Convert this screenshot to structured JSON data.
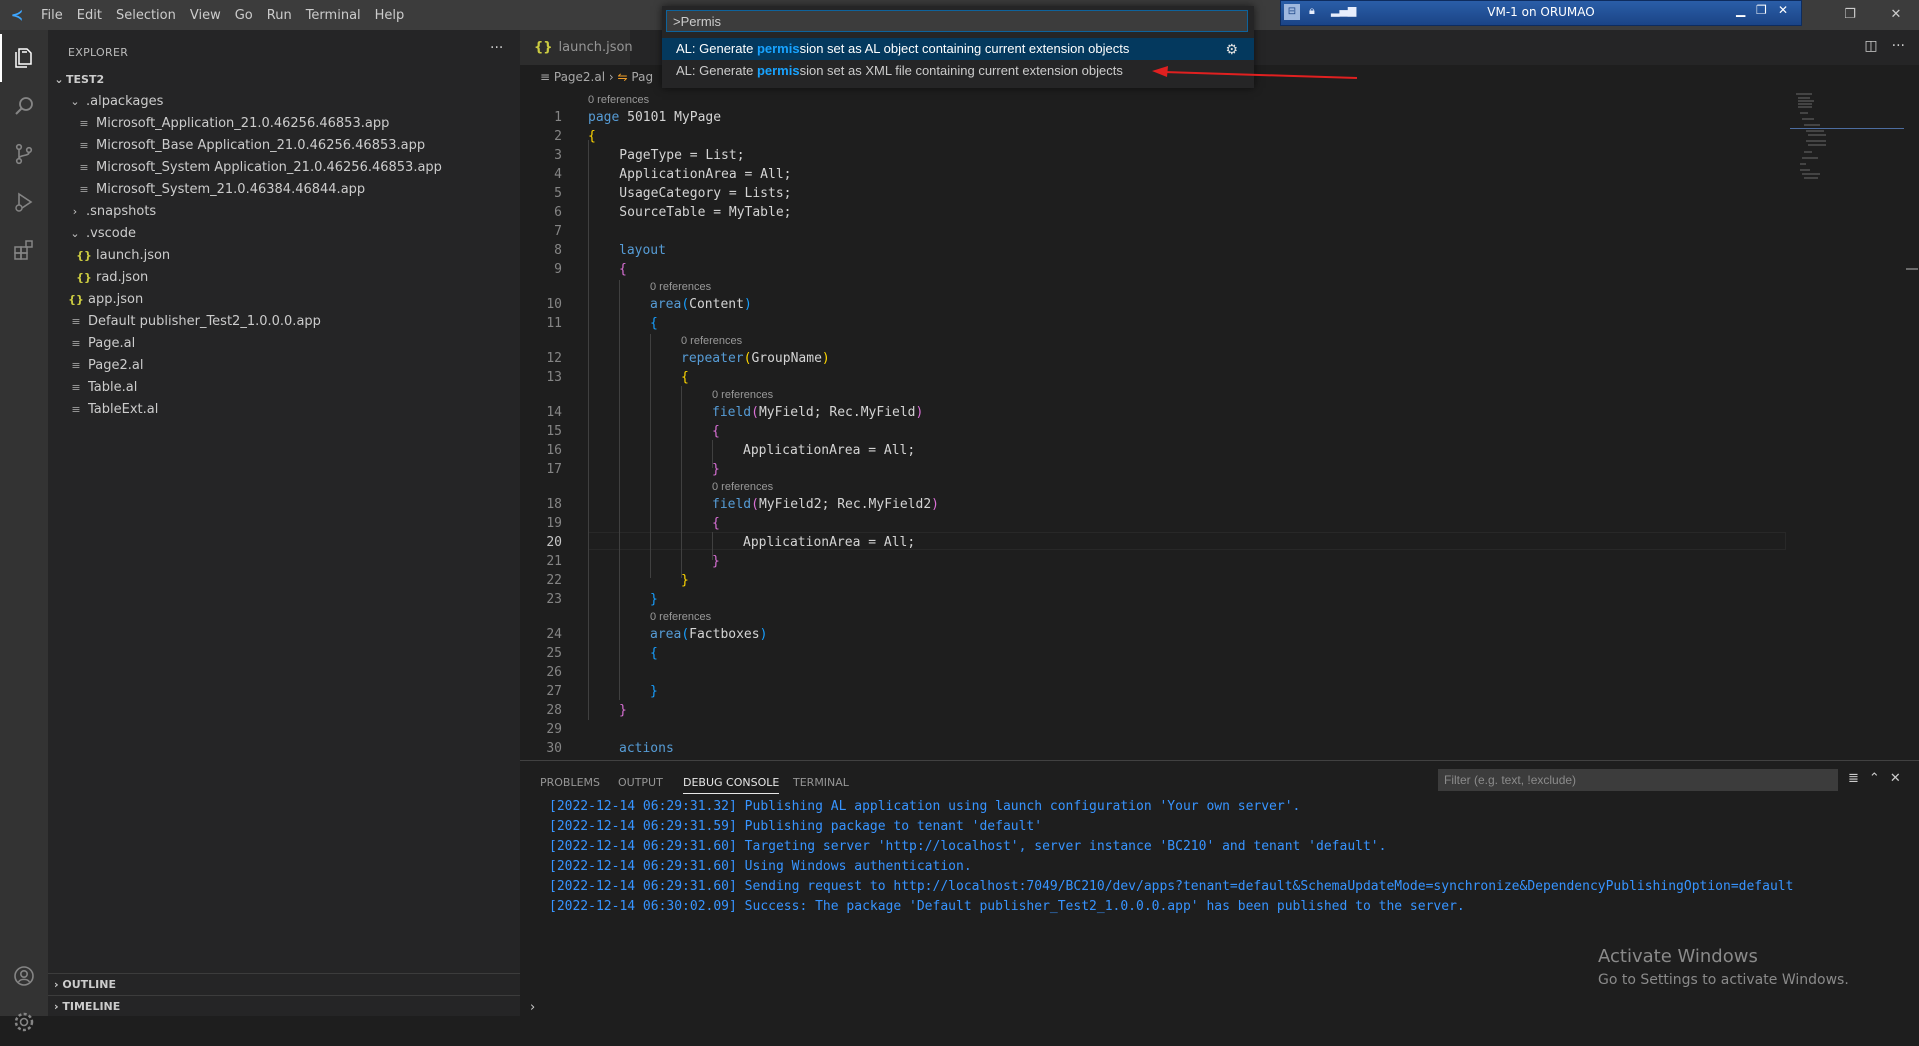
{
  "titlebar": {
    "menu": [
      "File",
      "Edit",
      "Selection",
      "View",
      "Go",
      "Run",
      "Terminal",
      "Help"
    ]
  },
  "vm": {
    "title": "VM-1 on ORUMAO"
  },
  "explorer": {
    "title": "EXPLORER",
    "root": "TEST2",
    "items": [
      {
        "label": ".alpackages",
        "type": "folder-open",
        "depth": 1
      },
      {
        "label": "Microsoft_Application_21.0.46256.46853.app",
        "type": "file",
        "depth": 2
      },
      {
        "label": "Microsoft_Base Application_21.0.46256.46853.app",
        "type": "file",
        "depth": 2
      },
      {
        "label": "Microsoft_System Application_21.0.46256.46853.app",
        "type": "file",
        "depth": 2
      },
      {
        "label": "Microsoft_System_21.0.46384.46844.app",
        "type": "file",
        "depth": 2
      },
      {
        "label": ".snapshots",
        "type": "folder-closed",
        "depth": 1
      },
      {
        "label": ".vscode",
        "type": "folder-open",
        "depth": 1
      },
      {
        "label": "launch.json",
        "type": "json",
        "depth": 2
      },
      {
        "label": "rad.json",
        "type": "json",
        "depth": 2
      },
      {
        "label": "app.json",
        "type": "json",
        "depth": 1
      },
      {
        "label": "Default publisher_Test2_1.0.0.0.app",
        "type": "file",
        "depth": 1
      },
      {
        "label": "Page.al",
        "type": "file",
        "depth": 1
      },
      {
        "label": "Page2.al",
        "type": "file",
        "depth": 1
      },
      {
        "label": "Table.al",
        "type": "file",
        "depth": 1
      },
      {
        "label": "TableExt.al",
        "type": "file",
        "depth": 1
      }
    ],
    "outline": "OUTLINE",
    "timeline": "TIMELINE"
  },
  "editor": {
    "tab": "launch.json",
    "breadcrumb": [
      "Page2.al",
      "Pag"
    ],
    "lens_text": "0 references"
  },
  "palette": {
    "input": ">Permis",
    "items": [
      {
        "pre": "AL: Generate ",
        "hl": "permis",
        "post": "sion set as AL object containing current extension objects"
      },
      {
        "pre": "AL: Generate ",
        "hl": "permis",
        "post": "sion set as XML file containing current extension objects"
      }
    ]
  },
  "panel": {
    "tabs": [
      "PROBLEMS",
      "OUTPUT",
      "DEBUG CONSOLE",
      "TERMINAL"
    ],
    "active_tab": "DEBUG CONSOLE",
    "filter_placeholder": "Filter (e.g. text, !exclude)",
    "logs": [
      "[2022-12-14 06:29:31.32] Publishing AL application using launch configuration 'Your own server'.",
      "[2022-12-14 06:29:31.59] Publishing package to tenant 'default'",
      "[2022-12-14 06:29:31.60] Targeting server 'http://localhost', server instance 'BC210' and tenant 'default'.",
      "[2022-12-14 06:29:31.60] Using Windows authentication.",
      "[2022-12-14 06:29:31.60] Sending request to http://localhost:7049/BC210/dev/apps?tenant=default&SchemaUpdateMode=synchronize&DependencyPublishingOption=default",
      "[2022-12-14 06:30:02.09] Success: The package 'Default publisher_Test2_1.0.0.0.app' has been published to the server."
    ]
  },
  "watermark": {
    "line1": "Activate Windows",
    "line2": "Go to Settings to activate Windows."
  },
  "code": {
    "l1": "page",
    "l1b": " 50101 MyPage",
    "l2": "{",
    "l3": "    PageType = List;",
    "l4": "    ApplicationArea = All;",
    "l5": "    UsageCategory = Lists;",
    "l6": "    SourceTable = MyTable;",
    "l8": "layout",
    "l9": "{",
    "l10a": "area",
    "l10b": "(",
    "l10c": "Content",
    "l10d": ")",
    "l11": "{",
    "l12a": "repeater",
    "l12b": "(",
    "l12c": "GroupName",
    "l12d": ")",
    "l13": "{",
    "l14a": "field",
    "l14b": "(",
    "l14c": "MyField; Rec.MyField",
    "l14d": ")",
    "l15": "{",
    "l16": "ApplicationArea = All;",
    "l17": "}",
    "l18a": "field",
    "l18b": "(",
    "l18c": "MyField2; Rec.MyField2",
    "l18d": ")",
    "l19": "{",
    "l20": "ApplicationArea = All;",
    "l21": "}",
    "l22": "}",
    "l23": "}",
    "l24a": "area",
    "l24b": "(",
    "l24c": "Factboxes",
    "l24d": ")",
    "l25": "{",
    "l27": "}",
    "l28": "}",
    "l30": "actions",
    "numbers": [
      "1",
      "2",
      "3",
      "4",
      "5",
      "6",
      "7",
      "8",
      "9",
      "10",
      "11",
      "12",
      "13",
      "14",
      "15",
      "16",
      "17",
      "18",
      "19",
      "20",
      "21",
      "22",
      "23",
      "24",
      "25",
      "26",
      "27",
      "28",
      "29",
      "30"
    ],
    "current_line": "20"
  }
}
